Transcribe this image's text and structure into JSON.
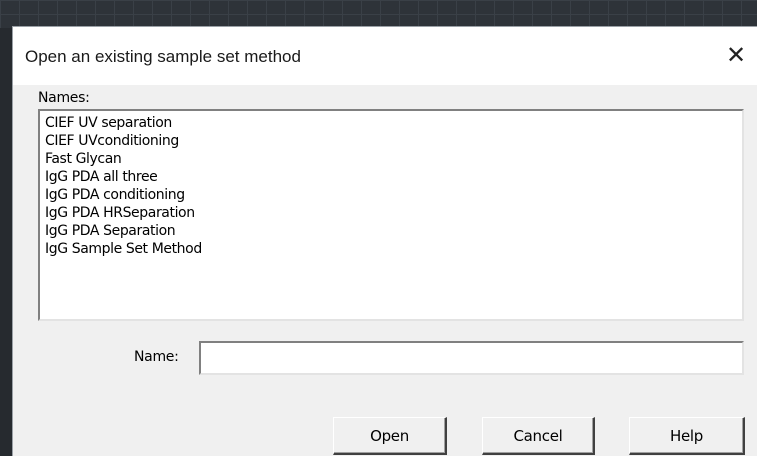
{
  "dialog": {
    "title": "Open an existing sample set method",
    "close_symbol": "✕"
  },
  "names": {
    "label": "Names:",
    "items": [
      "CIEF UV separation",
      "CIEF UVconditioning",
      "Fast Glycan",
      "IgG PDA all three",
      "IgG PDA conditioning",
      "IgG PDA HRSeparation",
      "IgG PDA Separation",
      "IgG Sample Set Method"
    ]
  },
  "name_field": {
    "label": "Name:",
    "value": ""
  },
  "buttons": {
    "open": "Open",
    "cancel": "Cancel",
    "help": "Help"
  },
  "icons": {
    "close": "close-icon"
  }
}
